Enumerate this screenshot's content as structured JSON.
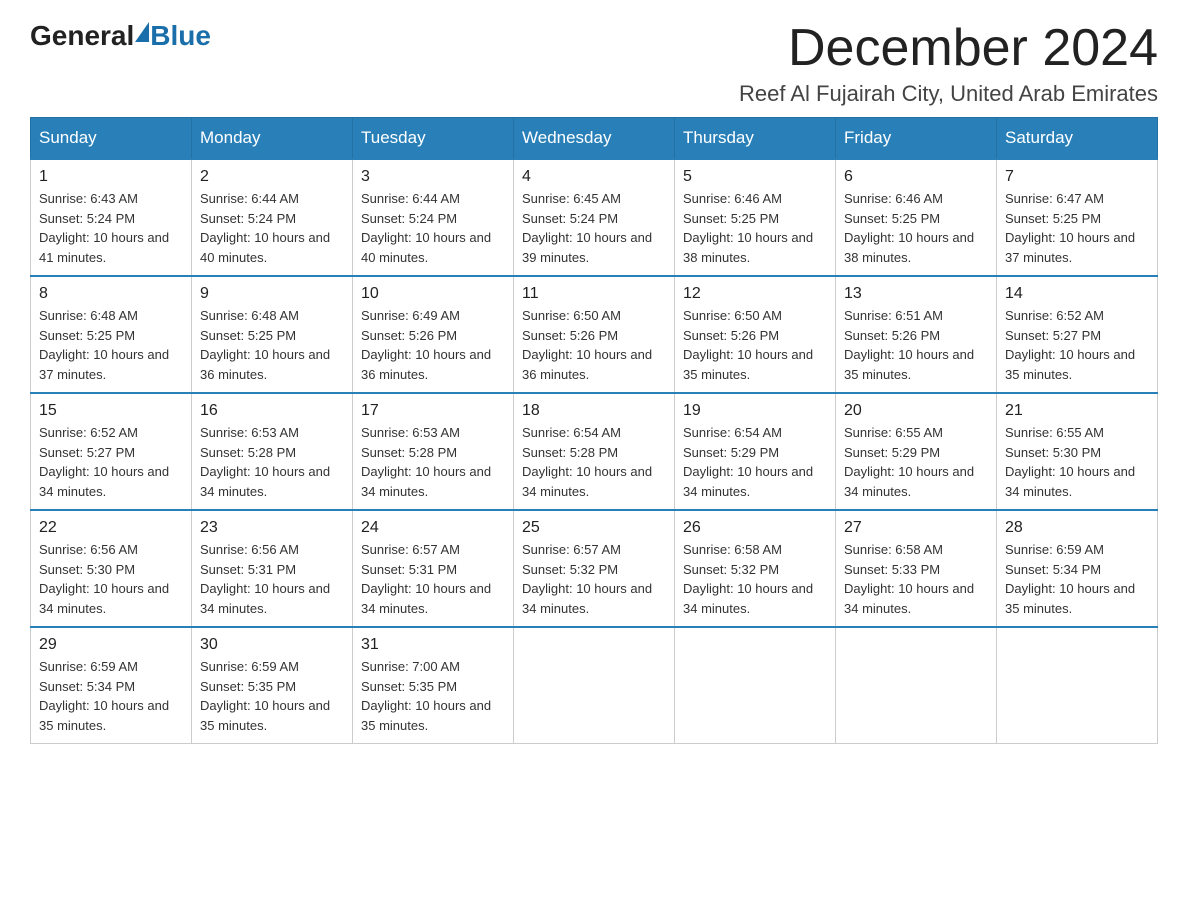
{
  "logo": {
    "general": "General",
    "blue": "Blue",
    "icon": "▶"
  },
  "header": {
    "month_title": "December 2024",
    "location": "Reef Al Fujairah City, United Arab Emirates"
  },
  "weekdays": [
    "Sunday",
    "Monday",
    "Tuesday",
    "Wednesday",
    "Thursday",
    "Friday",
    "Saturday"
  ],
  "weeks": [
    [
      {
        "day": "1",
        "sunrise": "6:43 AM",
        "sunset": "5:24 PM",
        "daylight": "10 hours and 41 minutes."
      },
      {
        "day": "2",
        "sunrise": "6:44 AM",
        "sunset": "5:24 PM",
        "daylight": "10 hours and 40 minutes."
      },
      {
        "day": "3",
        "sunrise": "6:44 AM",
        "sunset": "5:24 PM",
        "daylight": "10 hours and 40 minutes."
      },
      {
        "day": "4",
        "sunrise": "6:45 AM",
        "sunset": "5:24 PM",
        "daylight": "10 hours and 39 minutes."
      },
      {
        "day": "5",
        "sunrise": "6:46 AM",
        "sunset": "5:25 PM",
        "daylight": "10 hours and 38 minutes."
      },
      {
        "day": "6",
        "sunrise": "6:46 AM",
        "sunset": "5:25 PM",
        "daylight": "10 hours and 38 minutes."
      },
      {
        "day": "7",
        "sunrise": "6:47 AM",
        "sunset": "5:25 PM",
        "daylight": "10 hours and 37 minutes."
      }
    ],
    [
      {
        "day": "8",
        "sunrise": "6:48 AM",
        "sunset": "5:25 PM",
        "daylight": "10 hours and 37 minutes."
      },
      {
        "day": "9",
        "sunrise": "6:48 AM",
        "sunset": "5:25 PM",
        "daylight": "10 hours and 36 minutes."
      },
      {
        "day": "10",
        "sunrise": "6:49 AM",
        "sunset": "5:26 PM",
        "daylight": "10 hours and 36 minutes."
      },
      {
        "day": "11",
        "sunrise": "6:50 AM",
        "sunset": "5:26 PM",
        "daylight": "10 hours and 36 minutes."
      },
      {
        "day": "12",
        "sunrise": "6:50 AM",
        "sunset": "5:26 PM",
        "daylight": "10 hours and 35 minutes."
      },
      {
        "day": "13",
        "sunrise": "6:51 AM",
        "sunset": "5:26 PM",
        "daylight": "10 hours and 35 minutes."
      },
      {
        "day": "14",
        "sunrise": "6:52 AM",
        "sunset": "5:27 PM",
        "daylight": "10 hours and 35 minutes."
      }
    ],
    [
      {
        "day": "15",
        "sunrise": "6:52 AM",
        "sunset": "5:27 PM",
        "daylight": "10 hours and 34 minutes."
      },
      {
        "day": "16",
        "sunrise": "6:53 AM",
        "sunset": "5:28 PM",
        "daylight": "10 hours and 34 minutes."
      },
      {
        "day": "17",
        "sunrise": "6:53 AM",
        "sunset": "5:28 PM",
        "daylight": "10 hours and 34 minutes."
      },
      {
        "day": "18",
        "sunrise": "6:54 AM",
        "sunset": "5:28 PM",
        "daylight": "10 hours and 34 minutes."
      },
      {
        "day": "19",
        "sunrise": "6:54 AM",
        "sunset": "5:29 PM",
        "daylight": "10 hours and 34 minutes."
      },
      {
        "day": "20",
        "sunrise": "6:55 AM",
        "sunset": "5:29 PM",
        "daylight": "10 hours and 34 minutes."
      },
      {
        "day": "21",
        "sunrise": "6:55 AM",
        "sunset": "5:30 PM",
        "daylight": "10 hours and 34 minutes."
      }
    ],
    [
      {
        "day": "22",
        "sunrise": "6:56 AM",
        "sunset": "5:30 PM",
        "daylight": "10 hours and 34 minutes."
      },
      {
        "day": "23",
        "sunrise": "6:56 AM",
        "sunset": "5:31 PM",
        "daylight": "10 hours and 34 minutes."
      },
      {
        "day": "24",
        "sunrise": "6:57 AM",
        "sunset": "5:31 PM",
        "daylight": "10 hours and 34 minutes."
      },
      {
        "day": "25",
        "sunrise": "6:57 AM",
        "sunset": "5:32 PM",
        "daylight": "10 hours and 34 minutes."
      },
      {
        "day": "26",
        "sunrise": "6:58 AM",
        "sunset": "5:32 PM",
        "daylight": "10 hours and 34 minutes."
      },
      {
        "day": "27",
        "sunrise": "6:58 AM",
        "sunset": "5:33 PM",
        "daylight": "10 hours and 34 minutes."
      },
      {
        "day": "28",
        "sunrise": "6:59 AM",
        "sunset": "5:34 PM",
        "daylight": "10 hours and 35 minutes."
      }
    ],
    [
      {
        "day": "29",
        "sunrise": "6:59 AM",
        "sunset": "5:34 PM",
        "daylight": "10 hours and 35 minutes."
      },
      {
        "day": "30",
        "sunrise": "6:59 AM",
        "sunset": "5:35 PM",
        "daylight": "10 hours and 35 minutes."
      },
      {
        "day": "31",
        "sunrise": "7:00 AM",
        "sunset": "5:35 PM",
        "daylight": "10 hours and 35 minutes."
      },
      null,
      null,
      null,
      null
    ]
  ]
}
